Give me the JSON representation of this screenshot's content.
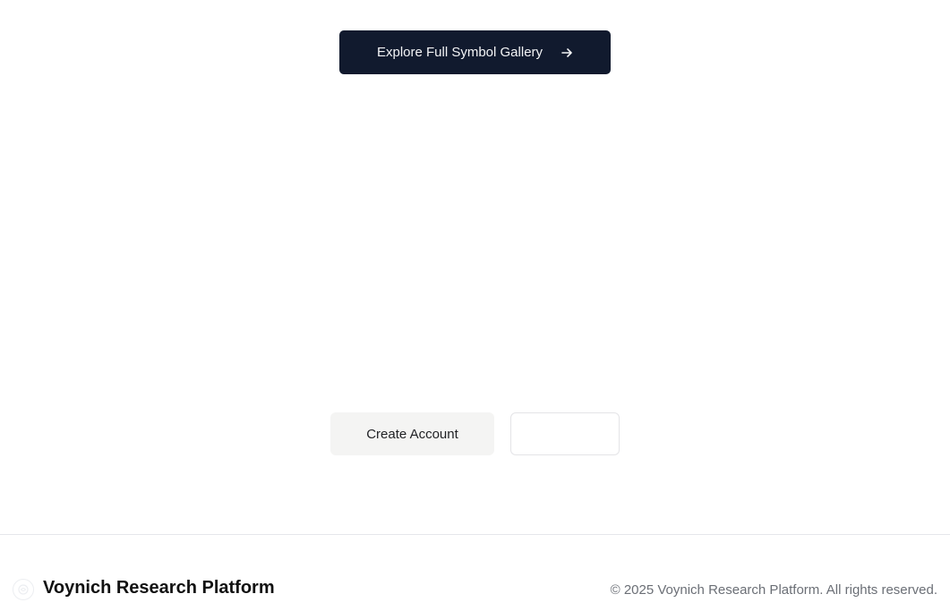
{
  "gallery": {
    "label": "Explore Full Symbol Gallery",
    "icon": "arrow-right-icon"
  },
  "actions": {
    "create_account_label": "Create Account",
    "secondary_label": ""
  },
  "footer": {
    "logo_icon": "voynich-logo-icon",
    "brand": "Voynich Research Platform",
    "copyright": "© 2025 Voynich Research Platform. All rights reserved."
  },
  "colors": {
    "primary_button": "#111a2e",
    "secondary_button": "#f4f4f3",
    "border": "#e5e7eb",
    "muted_text": "#6b6f76"
  }
}
